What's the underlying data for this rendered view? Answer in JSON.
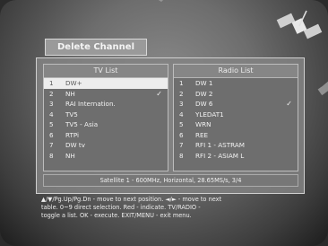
{
  "window": {
    "title": "Delete Channel"
  },
  "tv_list": {
    "header": "TV List",
    "items": [
      {
        "num": "1",
        "name": "DW+",
        "checked": false,
        "selected": true
      },
      {
        "num": "2",
        "name": "NH",
        "checked": true,
        "selected": false
      },
      {
        "num": "3",
        "name": "RAI Internation.",
        "checked": false,
        "selected": false
      },
      {
        "num": "4",
        "name": "TV5",
        "checked": false,
        "selected": false
      },
      {
        "num": "5",
        "name": "TV5 - Asia",
        "checked": false,
        "selected": false
      },
      {
        "num": "6",
        "name": "RTPi",
        "checked": false,
        "selected": false
      },
      {
        "num": "7",
        "name": "DW tv",
        "checked": false,
        "selected": false
      },
      {
        "num": "8",
        "name": "NH",
        "checked": false,
        "selected": false
      }
    ]
  },
  "radio_list": {
    "header": "Radio List",
    "items": [
      {
        "num": "1",
        "name": "DW 1",
        "checked": false,
        "selected": false
      },
      {
        "num": "2",
        "name": "DW 2",
        "checked": false,
        "selected": false
      },
      {
        "num": "3",
        "name": "DW 6",
        "checked": true,
        "selected": false
      },
      {
        "num": "4",
        "name": "YLEDAT1",
        "checked": false,
        "selected": false
      },
      {
        "num": "5",
        "name": "WRN",
        "checked": false,
        "selected": false
      },
      {
        "num": "6",
        "name": "REE",
        "checked": false,
        "selected": false
      },
      {
        "num": "7",
        "name": "RFI 1 - ASTRAM",
        "checked": false,
        "selected": false
      },
      {
        "num": "8",
        "name": "RFI 2 - ASIAM L",
        "checked": false,
        "selected": false
      }
    ]
  },
  "status_line": "Satellite 1 - 600MHz, Horizontal, 28.65MS/s, 3/4",
  "help": {
    "line1": "▲/▼/Pg.Up/Pg.Dn - move to next position. ◄/► - move to next",
    "line2": "table. 0~9 direct selection. Red - indicate. TV/RADIO -",
    "line3": "toggle a list. OK - execute. EXIT/MENU - exit menu."
  },
  "check_glyph": "✓"
}
